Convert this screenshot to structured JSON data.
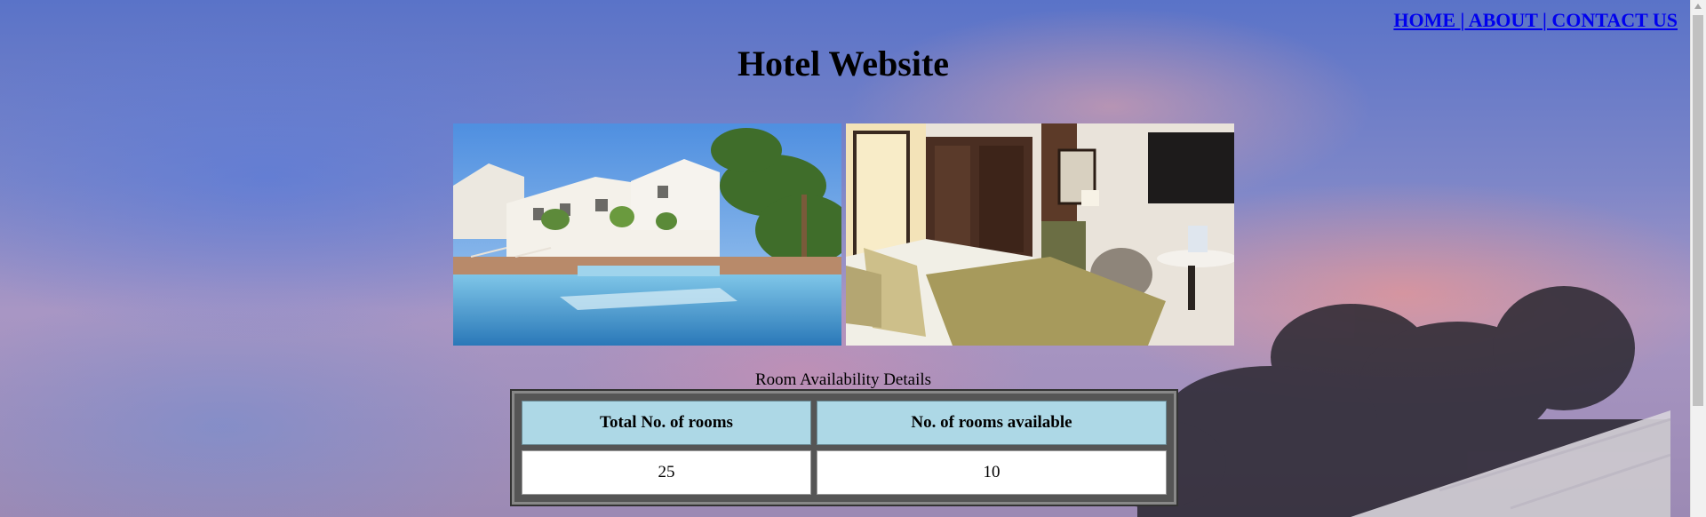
{
  "nav": {
    "home": "HOME ",
    "sep1": "|",
    "about": " ABOUT ",
    "sep2": "|",
    "contact": " CONTACT US"
  },
  "page": {
    "title": "Hotel Website"
  },
  "gallery": {
    "images": [
      "hotel-pool-photo",
      "hotel-room-photo"
    ]
  },
  "availability": {
    "caption": "Room Availability Details",
    "headers": [
      "Total No. of rooms",
      "No. of rooms available"
    ],
    "values": [
      "25",
      "10"
    ]
  },
  "colors": {
    "link": "#0000ee",
    "header_cell": "#add8e6",
    "table_frame": "#555555"
  }
}
